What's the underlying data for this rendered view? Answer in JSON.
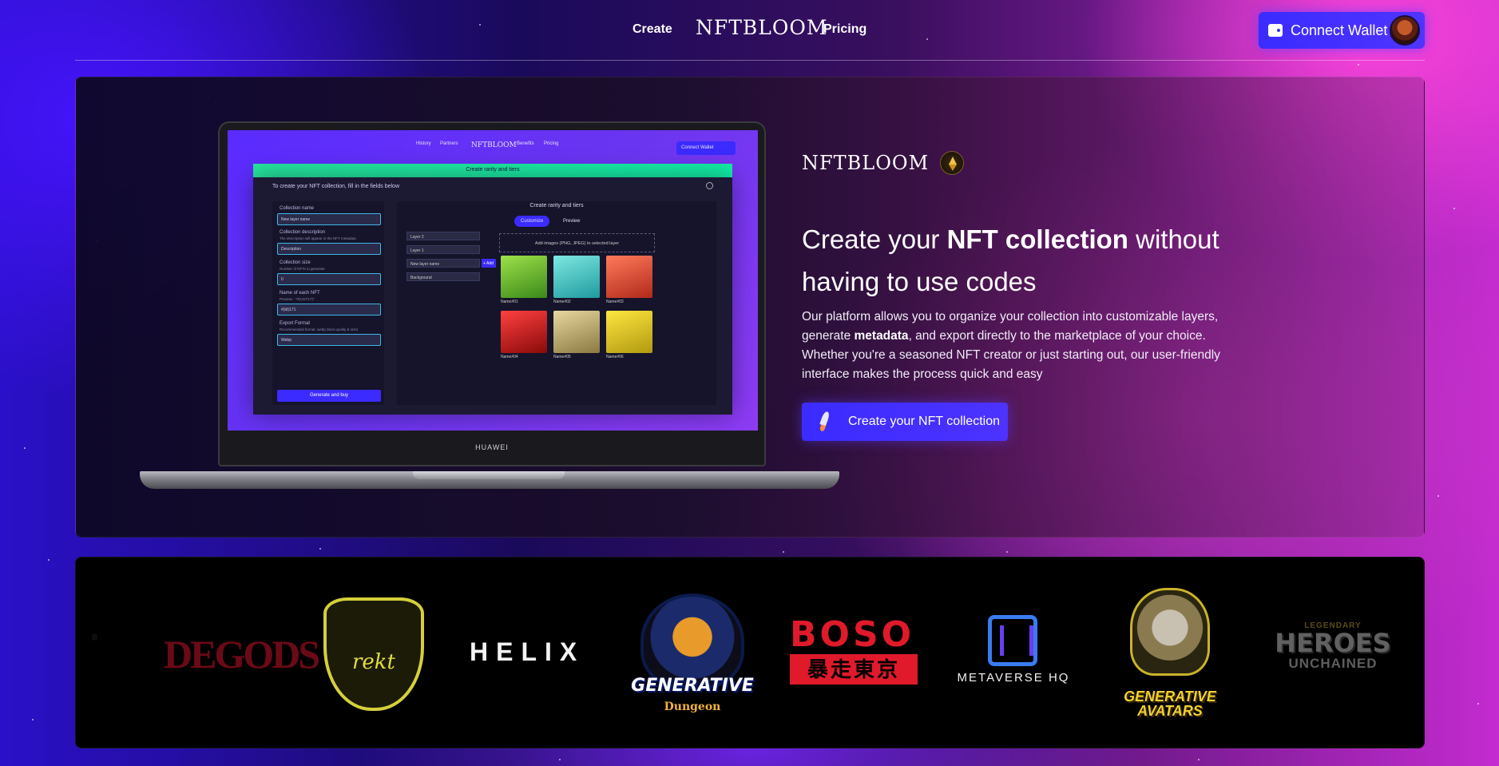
{
  "nav": {
    "create": "Create",
    "logo": "NFTBLOOM",
    "pricing": "Pricing",
    "wallet_label": "Connect Wallet",
    "wallet_icon": "wallet-icon",
    "avatar": "profile-avatar"
  },
  "hero": {
    "logo": "NFTBLOOM",
    "logo_icon": "ethereum-icon",
    "title_pre": "Create your ",
    "title_bold": "NFT collection",
    "title_post": " without having to use codes",
    "desc_1": "Our platform allows you to organize your collection into customizable layers, generate ",
    "desc_bold": "metadata",
    "desc_2": ", and export directly to the marketplace of your choice. Whether you're a seasoned NFT creator or just starting out, our user-friendly interface makes the process quick and easy",
    "cta_label": "Create your NFT collection",
    "cta_icon": "rocket-icon"
  },
  "laptop": {
    "brand": "HUAWEI",
    "nav_history": "History",
    "nav_partners": "Partners",
    "nav_logo": "NFTBLOOM",
    "nav_benefits": "Benefits",
    "nav_pricing": "Pricing",
    "nav_wallet": "Connect Wallet",
    "banner": "Create rarity and tiers",
    "intro": "To create your NFT collection, fill in the fields below",
    "form": {
      "collection_name_label": "Collection name",
      "collection_name_value": "New layer name",
      "description_label": "Collection description",
      "description_hint": "The description will appear in the NFT metadata",
      "description_value": "Description",
      "size_label": "Collection size",
      "size_hint": "Number of NFTs to generate",
      "size_value": "0",
      "each_label": "Name of each NFT",
      "each_hint": "Preview : \"#{142717}\"",
      "each_value": "#{id}171",
      "format_label": "Export Format",
      "format_hint": "Recommended format: webp (best quality & size)",
      "format_value": "Webp",
      "generate": "Generate and buy"
    },
    "right": {
      "title": "Create rarity and tiers",
      "tab_customize": "Customize",
      "tab_preview": "Preview",
      "layers": [
        "Layer 2",
        "Layer 1",
        "New layer name",
        "Background"
      ],
      "add": "+ Add",
      "upload": "Add images (PNG, JPEG) to selected layer",
      "nfts": [
        "Name#01",
        "Name#02",
        "Name#03",
        "Name#04",
        "Name#05",
        "Name#06"
      ]
    }
  },
  "partners": {
    "degods": "DEGODS",
    "rekt": "rekt",
    "helix": "HELIX",
    "generative_dungeon_1": "GENERATIVE",
    "generative_dungeon_2": "Dungeon",
    "boso_1": "BOSO",
    "boso_2": "暴走東京",
    "metaverse": "METAVERSE HQ",
    "avatars_1": "GENERATIVE",
    "avatars_2": "AVATARS",
    "heroes_1": "LEGENDARY",
    "heroes_2": "HEROES",
    "heroes_3": "UNCHAINED"
  }
}
